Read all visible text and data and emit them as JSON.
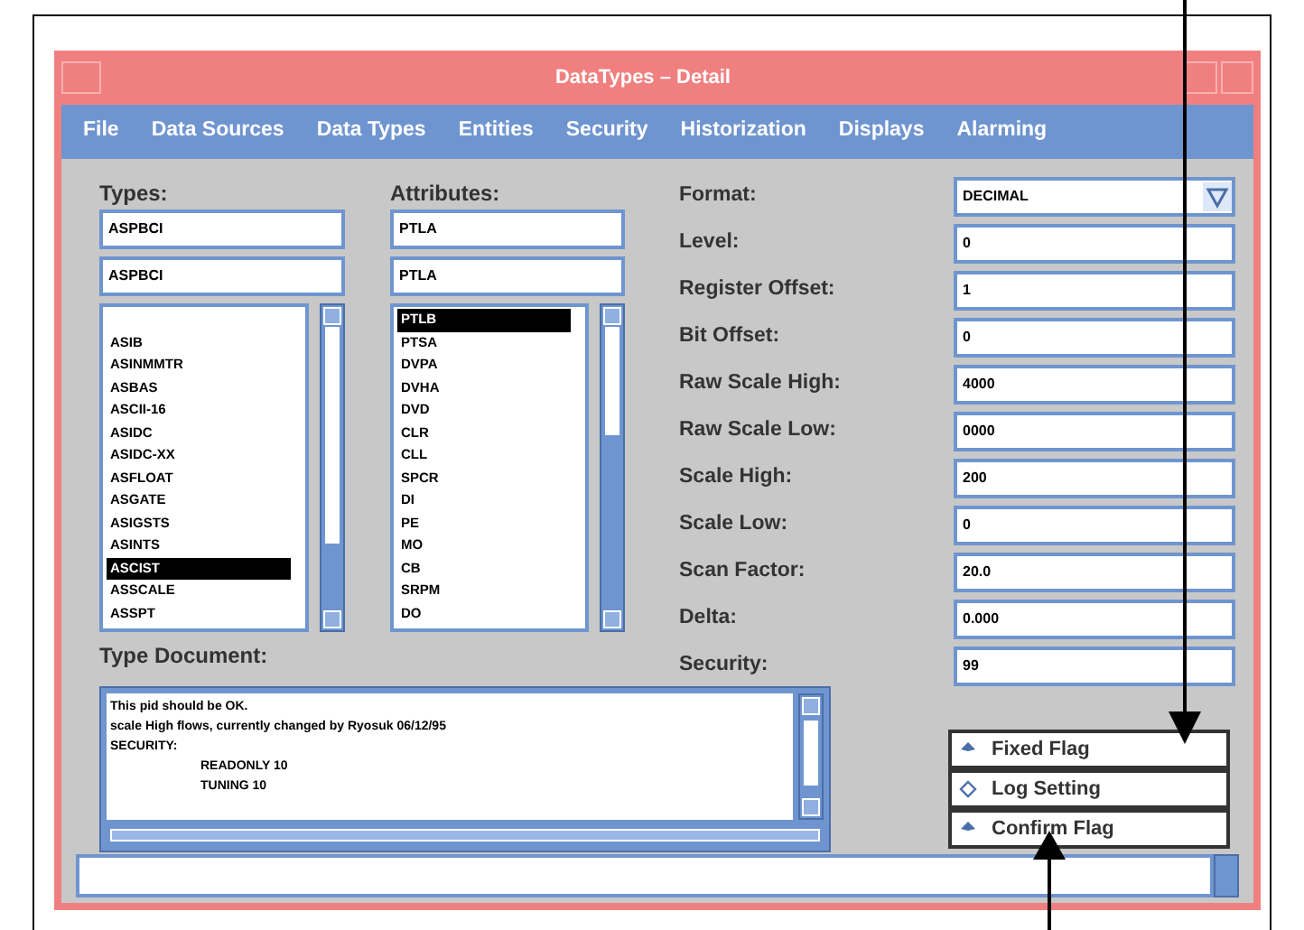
{
  "window": {
    "title": "DataTypes – Detail"
  },
  "menu": [
    "File",
    "Data Sources",
    "Data Types",
    "Entities",
    "Security",
    "Historization",
    "Displays",
    "Alarming"
  ],
  "types": {
    "label": "Types:",
    "filter": "ASPBCI",
    "selection": "ASPBCI",
    "items": [
      {
        "text": "ASIB",
        "selected": false
      },
      {
        "text": "ASINMMTR",
        "selected": false
      },
      {
        "text": "ASBAS",
        "selected": false
      },
      {
        "text": "ASCII-16",
        "selected": false
      },
      {
        "text": "ASIDC",
        "selected": false
      },
      {
        "text": "ASIDC-XX",
        "selected": false
      },
      {
        "text": "ASFLOAT",
        "selected": false
      },
      {
        "text": "ASGATE",
        "selected": false
      },
      {
        "text": "ASIGSTS",
        "selected": false
      },
      {
        "text": "ASINTS",
        "selected": false
      },
      {
        "text": "ASCIST",
        "selected": true
      },
      {
        "text": "ASSCALE",
        "selected": false
      },
      {
        "text": "ASSPT",
        "selected": false
      }
    ]
  },
  "attributes": {
    "label": "Attributes:",
    "filter": "PTLA",
    "selection": "PTLA",
    "items": [
      {
        "text": "PTLB",
        "selected": true
      },
      {
        "text": "PTSA",
        "selected": false
      },
      {
        "text": "DVPA",
        "selected": false
      },
      {
        "text": "DVHA",
        "selected": false
      },
      {
        "text": "DVD",
        "selected": false
      },
      {
        "text": "CLR",
        "selected": false
      },
      {
        "text": "CLL",
        "selected": false
      },
      {
        "text": "SPCR",
        "selected": false
      },
      {
        "text": "DI",
        "selected": false
      },
      {
        "text": "PE",
        "selected": false
      },
      {
        "text": "MO",
        "selected": false
      },
      {
        "text": "CB",
        "selected": false
      },
      {
        "text": "SRPM",
        "selected": false
      },
      {
        "text": "DO",
        "selected": false
      }
    ]
  },
  "fields": [
    {
      "label": "Format:",
      "value": "DECIMAL",
      "kind": "dropdown"
    },
    {
      "label": "Level:",
      "value": "0",
      "kind": "text"
    },
    {
      "label": "Register Offset:",
      "value": "1",
      "kind": "text"
    },
    {
      "label": "Bit Offset:",
      "value": "0",
      "kind": "text"
    },
    {
      "label": "Raw Scale High:",
      "value": "4000",
      "kind": "text"
    },
    {
      "label": "Raw Scale Low:",
      "value": "0000",
      "kind": "text"
    },
    {
      "label": "Scale High:",
      "value": "200",
      "kind": "text"
    },
    {
      "label": "Scale Low:",
      "value": "0",
      "kind": "text"
    },
    {
      "label": "Scan Factor:",
      "value": "20.0",
      "kind": "text"
    },
    {
      "label": "Delta:",
      "value": "0.000",
      "kind": "text"
    },
    {
      "label": "Security:",
      "value": "99",
      "kind": "text"
    }
  ],
  "type_document": {
    "label": "Type Document:",
    "lines": [
      {
        "text": "This pid should be OK.",
        "indented": false
      },
      {
        "text": "scale High flows, currently changed by Ryosuk 06/12/95",
        "indented": false
      },
      {
        "text": "SECURITY:",
        "indented": false
      },
      {
        "text": "READONLY 10",
        "indented": true
      },
      {
        "text": "TUNING 10",
        "indented": true
      }
    ]
  },
  "toggles": [
    {
      "label": "Fixed Flag",
      "checked": true
    },
    {
      "label": "Log Setting",
      "checked": false
    },
    {
      "label": "Confirm Flag",
      "checked": true
    }
  ],
  "callouts": [
    {
      "kind": "down"
    },
    {
      "kind": "up"
    }
  ]
}
